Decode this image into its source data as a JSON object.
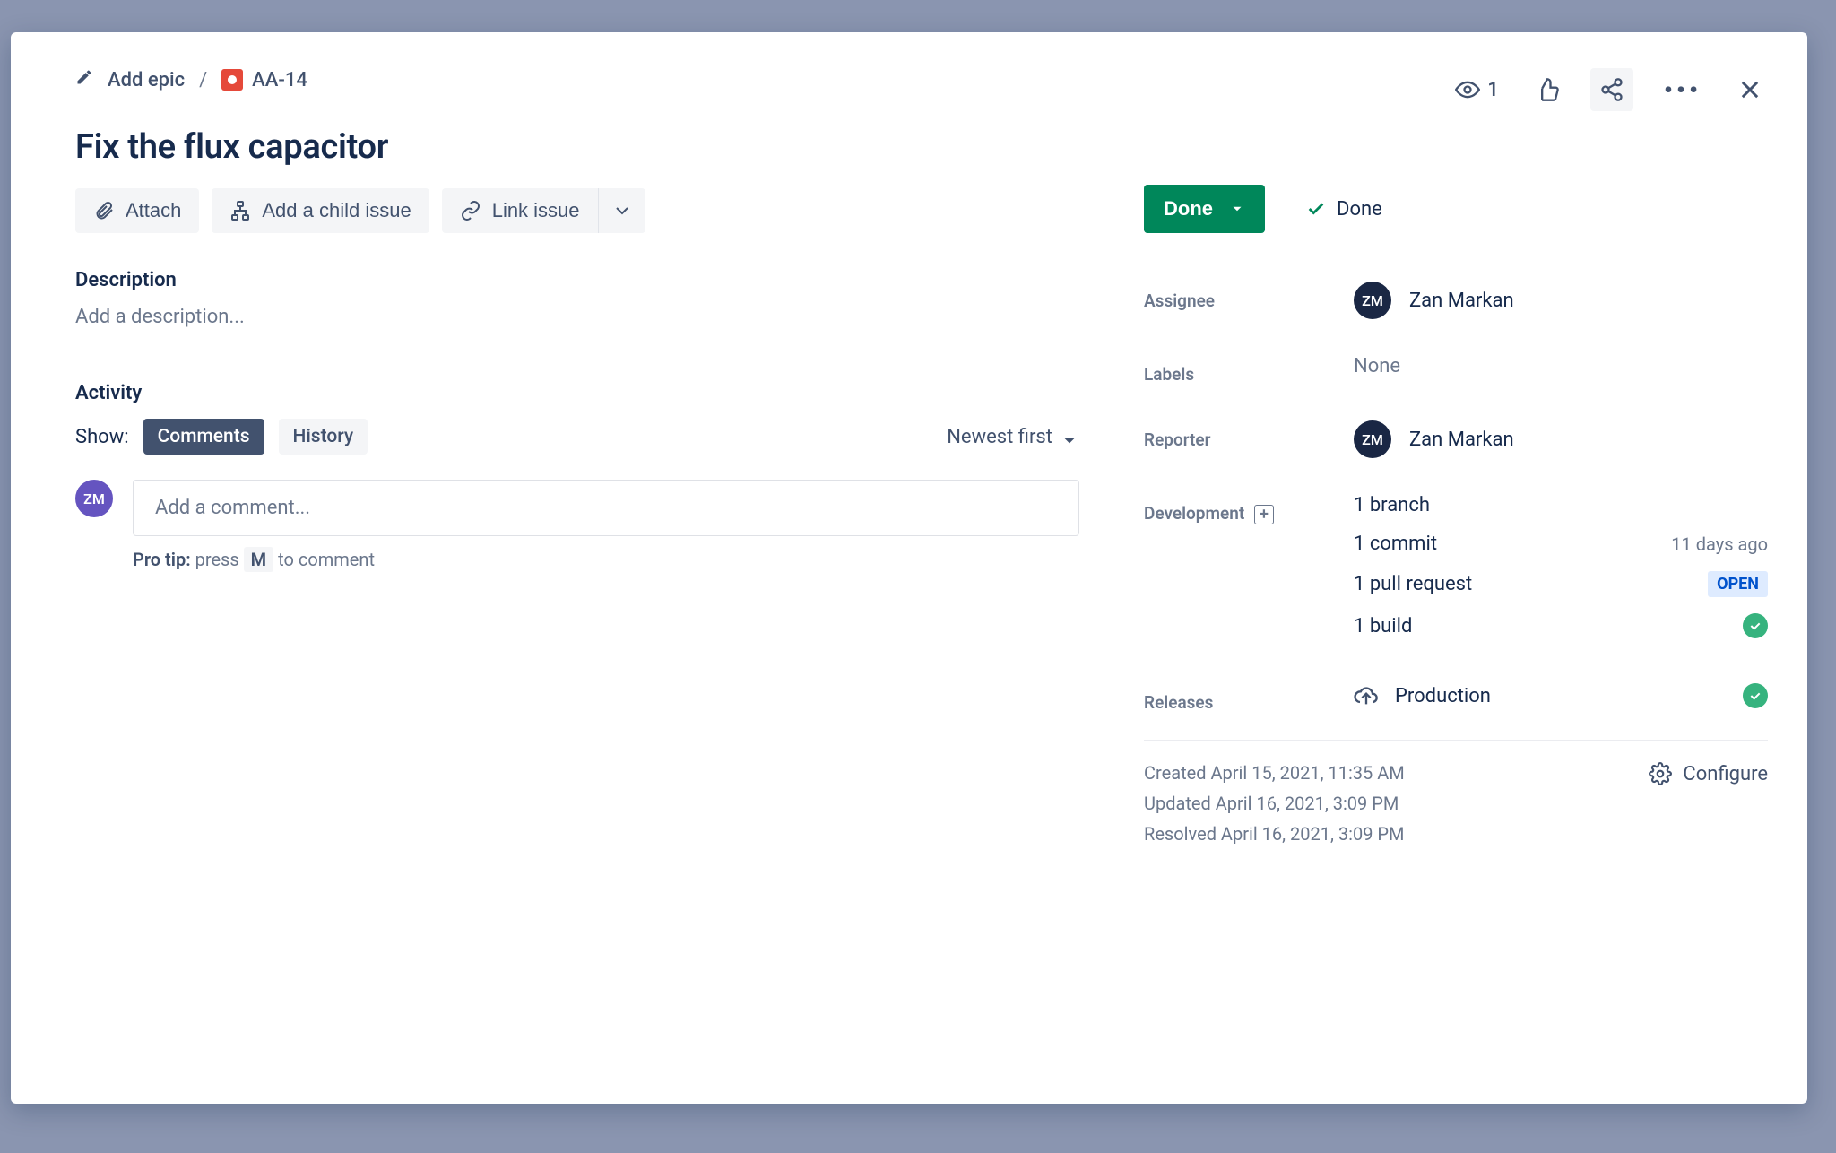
{
  "breadcrumb": {
    "add_epic": "Add epic",
    "issue_key": "AA-14"
  },
  "summary": "Fix the flux capacitor",
  "buttons": {
    "attach": "Attach",
    "add_child": "Add a child issue",
    "link_issue": "Link issue"
  },
  "description": {
    "label": "Description",
    "placeholder": "Add a description..."
  },
  "activity": {
    "label": "Activity",
    "show": "Show:",
    "tabs": {
      "comments": "Comments",
      "history": "History"
    },
    "sort": "Newest first"
  },
  "comment": {
    "avatar": "ZM",
    "placeholder": "Add a comment...",
    "protip_lead": "Pro tip:",
    "protip_a": "press",
    "protip_key": "M",
    "protip_b": "to comment"
  },
  "top": {
    "watch_count": "1"
  },
  "status": {
    "button": "Done",
    "resolution": "Done"
  },
  "details": {
    "assignee": {
      "label": "Assignee",
      "initials": "ZM",
      "name": "Zan Markan"
    },
    "labels": {
      "label": "Labels",
      "value": "None"
    },
    "reporter": {
      "label": "Reporter",
      "initials": "ZM",
      "name": "Zan Markan"
    },
    "development": {
      "label": "Development",
      "branch": "1 branch",
      "commit": "1 commit",
      "commit_time": "11 days ago",
      "pr": "1 pull request",
      "pr_badge": "OPEN",
      "build": "1 build"
    },
    "releases": {
      "label": "Releases",
      "name": "Production"
    }
  },
  "meta": {
    "created": "Created April 15, 2021, 11:35 AM",
    "updated": "Updated April 16, 2021, 3:09 PM",
    "resolved": "Resolved April 16, 2021, 3:09 PM",
    "configure": "Configure"
  }
}
